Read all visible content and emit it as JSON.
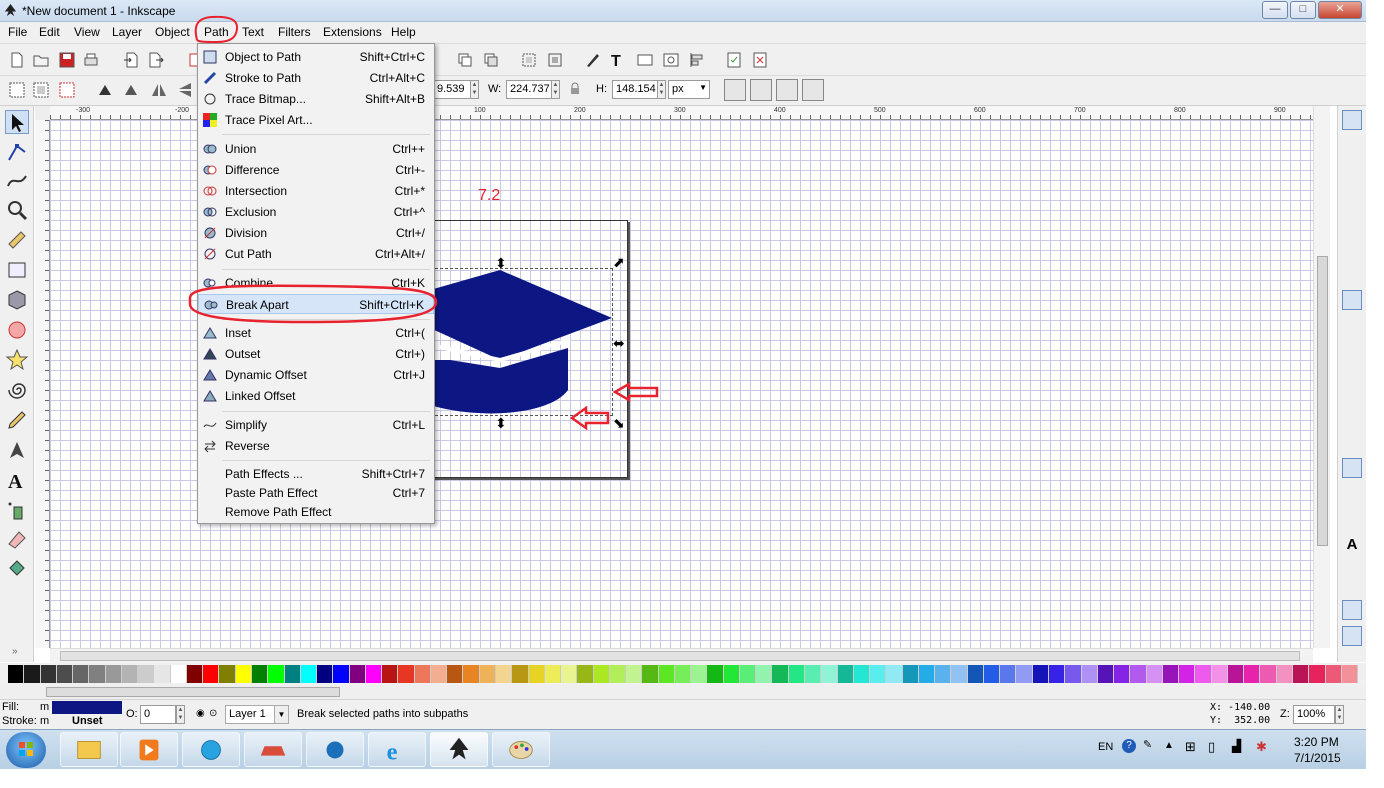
{
  "window": {
    "title": "*New document 1 - Inkscape",
    "minimize": "—",
    "maximize": "□",
    "close": "✕"
  },
  "menubar": [
    "File",
    "Edit",
    "View",
    "Layer",
    "Object",
    "Path",
    "Text",
    "Filters",
    "Extensions",
    "Help"
  ],
  "controls": {
    "x_value": "9.539",
    "w_label": "W:",
    "w_value": "224.737",
    "h_label": "H:",
    "h_value": "148.154",
    "unit": "px"
  },
  "path_menu": {
    "items": [
      {
        "label": "Object to Path",
        "shortcut": "Shift+Ctrl+C"
      },
      {
        "label": "Stroke to Path",
        "shortcut": "Ctrl+Alt+C"
      },
      {
        "label": "Trace Bitmap...",
        "shortcut": "Shift+Alt+B"
      },
      {
        "label": "Trace Pixel Art...",
        "shortcut": ""
      },
      {
        "label": "Union",
        "shortcut": "Ctrl++"
      },
      {
        "label": "Difference",
        "shortcut": "Ctrl+-"
      },
      {
        "label": "Intersection",
        "shortcut": "Ctrl+*"
      },
      {
        "label": "Exclusion",
        "shortcut": "Ctrl+^"
      },
      {
        "label": "Division",
        "shortcut": "Ctrl+/"
      },
      {
        "label": "Cut Path",
        "shortcut": "Ctrl+Alt+/"
      },
      {
        "label": "Combine",
        "shortcut": "Ctrl+K"
      },
      {
        "label": "Break Apart",
        "shortcut": "Shift+Ctrl+K"
      },
      {
        "label": "Inset",
        "shortcut": "Ctrl+("
      },
      {
        "label": "Outset",
        "shortcut": "Ctrl+)"
      },
      {
        "label": "Dynamic Offset",
        "shortcut": "Ctrl+J"
      },
      {
        "label": "Linked Offset",
        "shortcut": ""
      },
      {
        "label": "Simplify",
        "shortcut": "Ctrl+L"
      },
      {
        "label": "Reverse",
        "shortcut": ""
      },
      {
        "label": "Path Effects ...",
        "shortcut": "Shift+Ctrl+7"
      },
      {
        "label": "Paste Path Effect",
        "shortcut": "Ctrl+7"
      },
      {
        "label": "Remove Path Effect",
        "shortcut": ""
      }
    ]
  },
  "ruler": {
    "h_ticks": [
      "-300",
      "-200",
      "100",
      "200",
      "300",
      "400",
      "500",
      "600",
      "700",
      "800",
      "900"
    ]
  },
  "canvas": {
    "annotation_text": "7.2",
    "object_fill": "#0c1783"
  },
  "statusbar": {
    "fill_label": "Fill:",
    "fill_value": "m",
    "stroke_label": "Stroke:",
    "stroke_value": "m",
    "stroke_state": "Unset",
    "opacity_label": "O:",
    "opacity_value": "0",
    "layer": "Layer 1",
    "message": "Break selected paths into subpaths",
    "x_readout": "X: -140.00",
    "y_readout": "Y:  352.00",
    "zoom_label": "Z:",
    "zoom_value": "100%"
  },
  "taskbar": {
    "language": "EN",
    "time": "3:20 PM",
    "date": "7/1/2015"
  },
  "colors": {
    "accent_red": "#e8232f",
    "selection_fill": "#0c1783",
    "menu_highlight": "#d6e6f8"
  }
}
